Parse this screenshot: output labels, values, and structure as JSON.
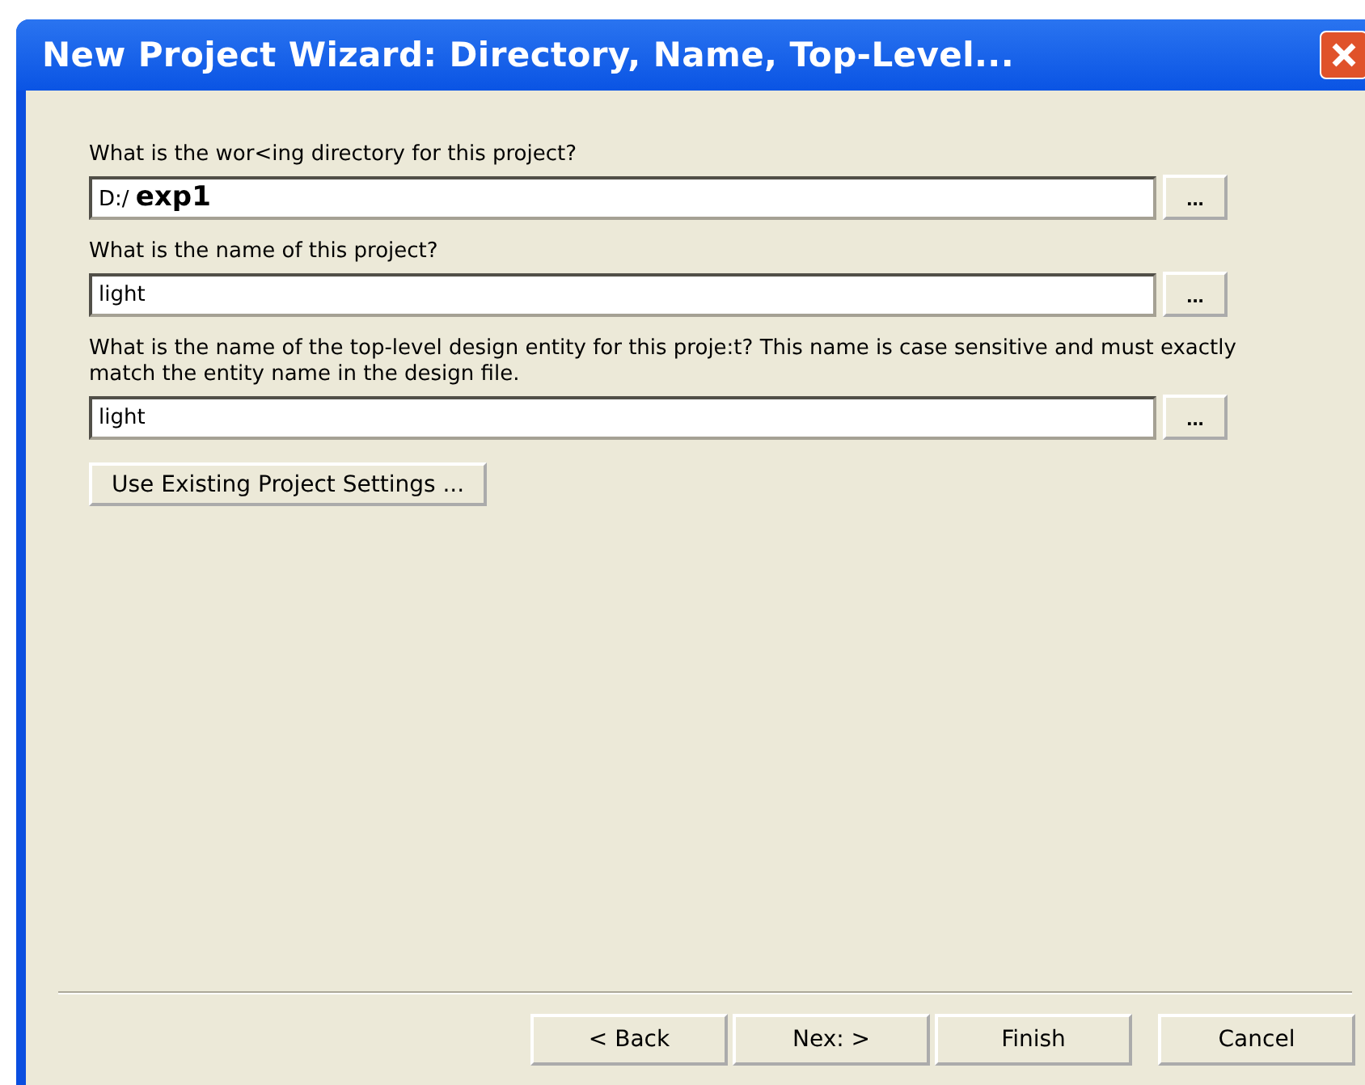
{
  "window": {
    "title": "New Project Wizard: Directory, Name, Top-Level..."
  },
  "fields": [
    {
      "label": "What is the wor<ing directory for this project?",
      "value": "D:/ **exp1**",
      "browse": "..."
    },
    {
      "label": "What is the name of this project?",
      "value": "light",
      "browse": "..."
    },
    {
      "label": "What is the name of the top-level design entity for this proje:t? This name is case sensitive and must exactly match the entity name in the design file.",
      "value": "light",
      "browse": "..."
    }
  ],
  "settings_button": "Use Existing Project Settings ...",
  "buttons": [
    {
      "label": "< Back"
    },
    {
      "label": "Nex: >"
    },
    {
      "label": "Finish"
    },
    {
      "label": "Cancel"
    }
  ]
}
